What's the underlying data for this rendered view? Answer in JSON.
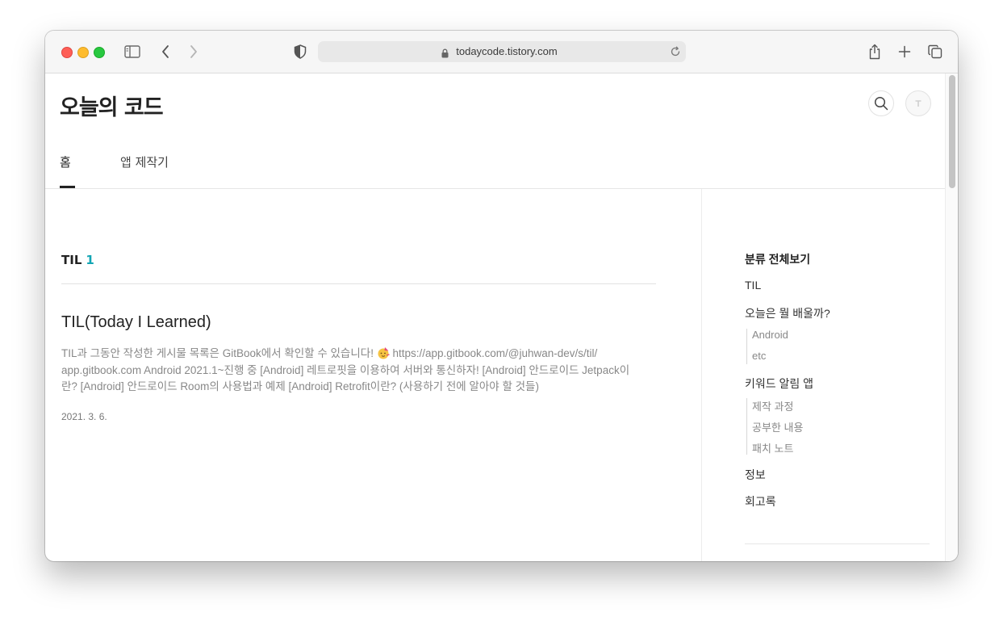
{
  "browser": {
    "url": "todaycode.tistory.com"
  },
  "blog": {
    "title": "오늘의 코드"
  },
  "nav": {
    "tabs": [
      {
        "label": "홈",
        "active": true
      },
      {
        "label": "앱 제작기",
        "active": false
      }
    ]
  },
  "category": {
    "name": "TIL",
    "count": "1"
  },
  "post": {
    "title": "TIL(Today I Learned)",
    "excerpt_before_emoji": "TIL과 그동안 작성한 게시물 목록은 GitBook에서 확인할 수 있습니다! ",
    "emoji": "face-with-party-hat-icon",
    "excerpt_after_emoji": " https://app.gitbook.com/@juhwan-dev/s/til/ app.gitbook.com Android 2021.1~진행 중 [Android] 레트로핏을 이용하여 서버와 통신하자! [Android] 안드로이드 Jetpack이란? [Android] 안드로이드 Room의 사용법과 예제 [Android] Retrofit이란? (사용하기 전에 알아야 할 것들)",
    "date": "2021. 3. 6."
  },
  "sidebar": {
    "all_label": "분류 전체보기",
    "items": [
      {
        "label": "TIL",
        "children": []
      },
      {
        "label": "오늘은 뭘 배울까?",
        "children": [
          "Android",
          "etc"
        ]
      },
      {
        "label": "키워드 알림 앱",
        "children": [
          "제작 과정",
          "공부한 내용",
          "패치 노트"
        ]
      },
      {
        "label": "정보",
        "children": []
      },
      {
        "label": "회고록",
        "children": []
      }
    ]
  },
  "colors": {
    "accent": "#12a5b4"
  }
}
